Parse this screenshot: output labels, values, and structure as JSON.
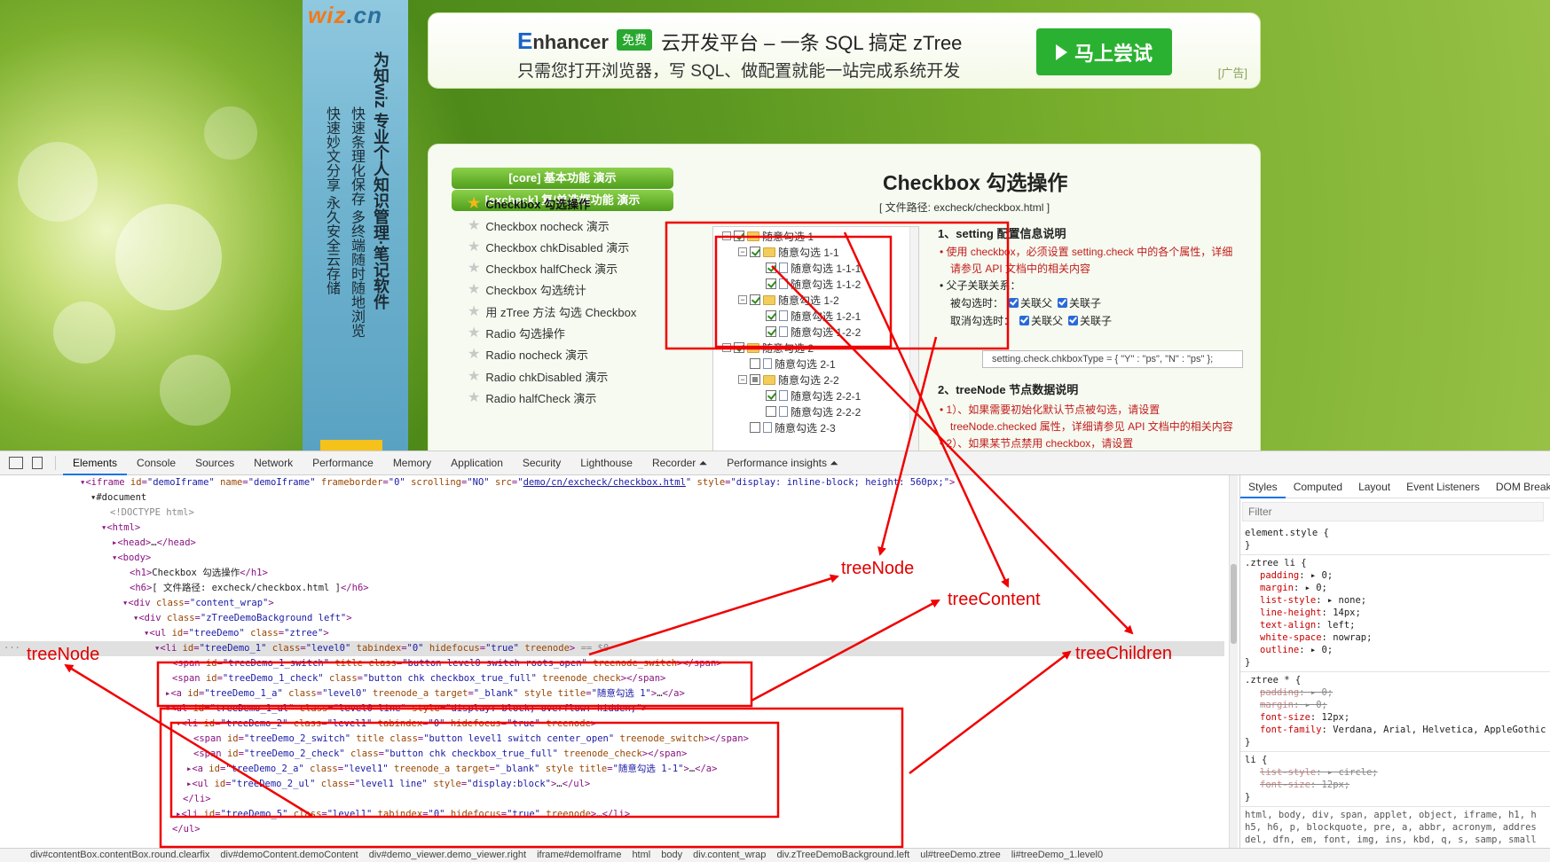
{
  "website": {
    "wiz": {
      "logo_main": "wiz",
      "logo_suffix": ".cn",
      "col1": "为知wiz 专业个人知识管理·笔记软件",
      "col2": "快速条理化保存 多终端随时随地浏览",
      "col3": "快速妙文分享  永久安全云存储"
    },
    "ad": {
      "brand_e": "E",
      "brand_rest": "nhancer",
      "free_badge": "免费",
      "title": "云开发平台 – 一条 SQL 搞定 zTree",
      "subtitle": "只需您打开浏览器，写 SQL、做配置就能一站完成系统开发",
      "button": "马上尝试",
      "mark": "[广告]"
    },
    "menu": {
      "buttons": [
        "[core] 基本功能 演示",
        "[excheck] 复/单选框功能 演示"
      ],
      "items": [
        {
          "label": "Checkbox 勾选操作",
          "active": true
        },
        {
          "label": "Checkbox nocheck 演示",
          "active": false
        },
        {
          "label": "Checkbox chkDisabled 演示",
          "active": false
        },
        {
          "label": "Checkbox halfCheck 演示",
          "active": false
        },
        {
          "label": "Checkbox 勾选统计",
          "active": false
        },
        {
          "label": "用 zTree 方法 勾选 Checkbox",
          "active": false
        },
        {
          "label": "Radio 勾选操作",
          "active": false
        },
        {
          "label": "Radio nocheck 演示",
          "active": false
        },
        {
          "label": "Radio chkDisabled 演示",
          "active": false
        },
        {
          "label": "Radio halfCheck 演示",
          "active": false
        }
      ]
    },
    "demo": {
      "title": "Checkbox 勾选操作",
      "path": "[ 文件路径: excheck/checkbox.html ]"
    },
    "tree": [
      {
        "label": "随意勾选 1",
        "level": 0,
        "switch": "−",
        "check": "full",
        "icon": "folder"
      },
      {
        "label": "随意勾选 1-1",
        "level": 1,
        "switch": "−",
        "check": "full",
        "icon": "folder"
      },
      {
        "label": "随意勾选 1-1-1",
        "level": 2,
        "switch": "",
        "check": "full",
        "icon": "file"
      },
      {
        "label": "随意勾选 1-1-2",
        "level": 2,
        "switch": "",
        "check": "full",
        "icon": "file"
      },
      {
        "label": "随意勾选 1-2",
        "level": 1,
        "switch": "−",
        "check": "full",
        "icon": "folder"
      },
      {
        "label": "随意勾选 1-2-1",
        "level": 2,
        "switch": "",
        "check": "full",
        "icon": "file"
      },
      {
        "label": "随意勾选 1-2-2",
        "level": 2,
        "switch": "",
        "check": "full",
        "icon": "file"
      },
      {
        "label": "随意勾选 2",
        "level": 0,
        "switch": "−",
        "check": "full",
        "icon": "folder"
      },
      {
        "label": "随意勾选 2-1",
        "level": 1,
        "switch": "",
        "check": "none",
        "icon": "file"
      },
      {
        "label": "随意勾选 2-2",
        "level": 1,
        "switch": "−",
        "check": "part",
        "icon": "folder"
      },
      {
        "label": "随意勾选 2-2-1",
        "level": 2,
        "switch": "",
        "check": "full",
        "icon": "file"
      },
      {
        "label": "随意勾选 2-2-2",
        "level": 2,
        "switch": "",
        "check": "none",
        "icon": "file"
      },
      {
        "label": "随意勾选 2-3",
        "level": 1,
        "switch": "",
        "check": "none",
        "icon": "file"
      }
    ],
    "info": {
      "h1": "1、setting 配置信息说明",
      "l1": "• 使用 checkbox，必须设置 setting.check 中的各个属性，详细",
      "l2": "请参见 API 文档中的相关内容",
      "l3": "• 父子关联关系：",
      "checked_label": "被勾选时：",
      "unchecked_label": "取消勾选时：",
      "rel_parent": "关联父",
      "rel_child": "关联子",
      "code": "setting.check.chkboxType = { \"Y\" : \"ps\", \"N\" : \"ps\" };",
      "h2": "2、treeNode 节点数据说明",
      "l4": "• 1）、如果需要初始化默认节点被勾选，请设置",
      "l5": "treeNode.checked 属性，详细请参见 API 文档中的相关内容",
      "l6": "• 2）、如果某节点禁用 checkbox，请设置"
    }
  },
  "devtools": {
    "tabs": [
      "Elements",
      "Console",
      "Sources",
      "Network",
      "Performance",
      "Memory",
      "Application",
      "Security",
      "Lighthouse",
      "Recorder ⏶",
      "Performance insights ⏶"
    ],
    "active_tab": "Elements",
    "styles_tabs": [
      "Styles",
      "Computed",
      "Layout",
      "Event Listeners",
      "DOM Break"
    ],
    "filter_placeholder": "Filter",
    "breadcrumbs": [
      "div#contentBox.contentBox.round.clearfix",
      "div#demoContent.demoContent",
      "div#demo_viewer.demo_viewer.right",
      "iframe#demoIframe",
      "html",
      "body",
      "div.content_wrap",
      "div.zTreeDemoBackground.left",
      "ul#treeDemo.ztree",
      "li#treeDemo_1.level0"
    ]
  },
  "annotations": {
    "treeNode_right": "treeNode",
    "treeContent": "treeContent",
    "treeChildren": "treeChildren",
    "treeNode_left": "treeNode"
  }
}
